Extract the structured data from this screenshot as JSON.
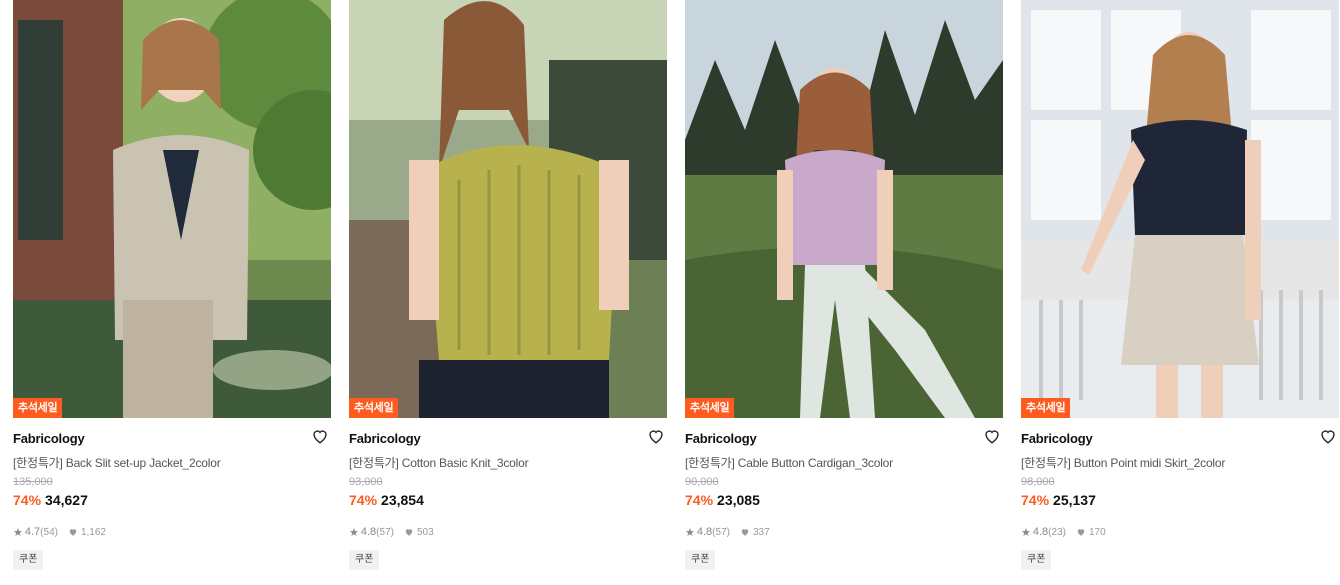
{
  "colors": {
    "accent": "#ff5a1f",
    "text": "#111111",
    "muted": "#888888"
  },
  "products": [
    {
      "badge": "추석세일",
      "brand": "Fabricology",
      "name": "[한정특가] Back Slit set-up Jacket_2color",
      "original_price": "135,000",
      "discount": "74%",
      "price": "34,627",
      "rating": "4.7",
      "review_count": "(54)",
      "likes": "1,162",
      "coupon": "쿠폰",
      "wish_icon": "heart-outline-icon"
    },
    {
      "badge": "추석세일",
      "brand": "Fabricology",
      "name": "[한정특가] Cotton Basic Knit_3color",
      "original_price": "93,000",
      "discount": "74%",
      "price": "23,854",
      "rating": "4.8",
      "review_count": "(57)",
      "likes": "503",
      "coupon": "쿠폰",
      "wish_icon": "heart-outline-icon"
    },
    {
      "badge": "추석세일",
      "brand": "Fabricology",
      "name": "[한정특가] Cable Button Cardigan_3color",
      "original_price": "90,000",
      "discount": "74%",
      "price": "23,085",
      "rating": "4.8",
      "review_count": "(57)",
      "likes": "337",
      "coupon": "쿠폰",
      "wish_icon": "heart-outline-icon"
    },
    {
      "badge": "추석세일",
      "brand": "Fabricology",
      "name": "[한정특가] Button Point midi Skirt_2color",
      "original_price": "98,000",
      "discount": "74%",
      "price": "25,137",
      "rating": "4.8",
      "review_count": "(23)",
      "likes": "170",
      "coupon": "쿠폰",
      "wish_icon": "heart-outline-icon"
    }
  ]
}
